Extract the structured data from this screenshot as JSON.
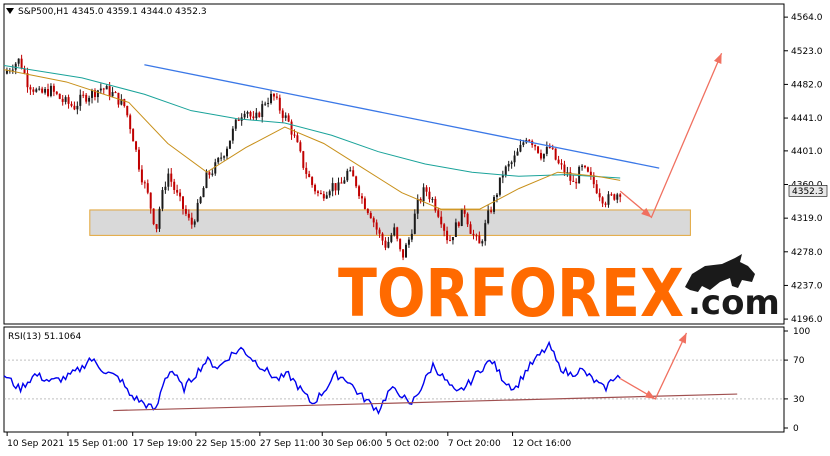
{
  "header": {
    "symbol_label": "S&P500,H1",
    "ohlc_label": "4345.0 4359.1 4344.0 4352.3"
  },
  "rsi": {
    "label": "RSI(13) 51.1064",
    "levels": [
      100,
      70,
      30,
      0
    ]
  },
  "watermark": {
    "brand_main": "TORFOREX",
    "brand_suffix": ".com"
  },
  "colors": {
    "candle_up": "#1a1a1a",
    "candle_down": "#c00000",
    "ma_fast": "#c8901a",
    "ma_slow": "#1aa39a",
    "trendline": "#3b78e7",
    "forecast_arrow": "#f07060",
    "rsi_line": "#0000ee",
    "rsi_support": "#a05050",
    "price_marker_bg": "#e8e8e8",
    "watermark_orange": "#ff6a00",
    "watermark_dark": "#1a1a1a"
  },
  "chart_data": {
    "type": "line",
    "instrument": "S&P500",
    "timeframe": "H1",
    "price_axis": {
      "ticks": [
        4564.0,
        4523.0,
        4482.0,
        4441.0,
        4401.0,
        4360.0,
        4319.0,
        4278.0,
        4237.0,
        4196.0
      ],
      "tick_labels": [
        "4564.0",
        "4523.0",
        "4482.0",
        "4441.0",
        "4401.0",
        "4360.0",
        "4319.0",
        "4278.0",
        "4237.0",
        "4196.0"
      ],
      "ylim": [
        4190,
        4580
      ]
    },
    "current_price": 4352.3,
    "current_price_label": "4352.3",
    "time_axis": {
      "labels": [
        "10 Sep 2021",
        "15 Sep 01:00",
        "17 Sep 19:00",
        "22 Sep 15:00",
        "27 Sep 11:00",
        "30 Sep 06:00",
        "5 Oct 02:00",
        "7 Oct 20:00",
        "12 Oct 16:00"
      ],
      "xlim": [
        0,
        1
      ]
    },
    "close_series": [
      [
        0.0,
        4495
      ],
      [
        0.01,
        4505
      ],
      [
        0.02,
        4512
      ],
      [
        0.03,
        4485
      ],
      [
        0.045,
        4470
      ],
      [
        0.06,
        4475
      ],
      [
        0.075,
        4462
      ],
      [
        0.09,
        4455
      ],
      [
        0.1,
        4465
      ],
      [
        0.11,
        4470
      ],
      [
        0.125,
        4478
      ],
      [
        0.14,
        4470
      ],
      [
        0.155,
        4455
      ],
      [
        0.165,
        4420
      ],
      [
        0.175,
        4375
      ],
      [
        0.185,
        4345
      ],
      [
        0.195,
        4305
      ],
      [
        0.2,
        4335
      ],
      [
        0.21,
        4375
      ],
      [
        0.22,
        4350
      ],
      [
        0.23,
        4330
      ],
      [
        0.24,
        4310
      ],
      [
        0.25,
        4335
      ],
      [
        0.26,
        4370
      ],
      [
        0.27,
        4380
      ],
      [
        0.285,
        4405
      ],
      [
        0.3,
        4440
      ],
      [
        0.31,
        4455
      ],
      [
        0.32,
        4435
      ],
      [
        0.335,
        4462
      ],
      [
        0.345,
        4468
      ],
      [
        0.355,
        4450
      ],
      [
        0.365,
        4435
      ],
      [
        0.375,
        4410
      ],
      [
        0.385,
        4380
      ],
      [
        0.395,
        4360
      ],
      [
        0.405,
        4345
      ],
      [
        0.42,
        4360
      ],
      [
        0.43,
        4355
      ],
      [
        0.44,
        4375
      ],
      [
        0.45,
        4365
      ],
      [
        0.46,
        4340
      ],
      [
        0.47,
        4325
      ],
      [
        0.48,
        4300
      ],
      [
        0.49,
        4285
      ],
      [
        0.5,
        4305
      ],
      [
        0.51,
        4270
      ],
      [
        0.52,
        4295
      ],
      [
        0.53,
        4335
      ],
      [
        0.54,
        4355
      ],
      [
        0.55,
        4340
      ],
      [
        0.56,
        4320
      ],
      [
        0.57,
        4290
      ],
      [
        0.58,
        4310
      ],
      [
        0.59,
        4330
      ],
      [
        0.6,
        4300
      ],
      [
        0.61,
        4285
      ],
      [
        0.62,
        4320
      ],
      [
        0.63,
        4345
      ],
      [
        0.64,
        4375
      ],
      [
        0.65,
        4385
      ],
      [
        0.66,
        4400
      ],
      [
        0.67,
        4420
      ],
      [
        0.68,
        4410
      ],
      [
        0.69,
        4395
      ],
      [
        0.7,
        4405
      ],
      [
        0.71,
        4385
      ],
      [
        0.72,
        4375
      ],
      [
        0.73,
        4360
      ],
      [
        0.74,
        4380
      ],
      [
        0.75,
        4370
      ],
      [
        0.76,
        4355
      ],
      [
        0.77,
        4340
      ],
      [
        0.78,
        4345
      ],
      [
        0.79,
        4352
      ]
    ],
    "ma_fast_series": [
      [
        0.0,
        4500
      ],
      [
        0.08,
        4485
      ],
      [
        0.16,
        4460
      ],
      [
        0.21,
        4410
      ],
      [
        0.26,
        4375
      ],
      [
        0.31,
        4405
      ],
      [
        0.36,
        4430
      ],
      [
        0.41,
        4410
      ],
      [
        0.46,
        4380
      ],
      [
        0.51,
        4350
      ],
      [
        0.56,
        4330
      ],
      [
        0.61,
        4330
      ],
      [
        0.66,
        4355
      ],
      [
        0.71,
        4375
      ],
      [
        0.76,
        4370
      ],
      [
        0.79,
        4365
      ]
    ],
    "ma_slow_series": [
      [
        0.0,
        4505
      ],
      [
        0.1,
        4490
      ],
      [
        0.18,
        4470
      ],
      [
        0.24,
        4450
      ],
      [
        0.3,
        4440
      ],
      [
        0.36,
        4435
      ],
      [
        0.42,
        4420
      ],
      [
        0.48,
        4400
      ],
      [
        0.54,
        4385
      ],
      [
        0.6,
        4375
      ],
      [
        0.66,
        4370
      ],
      [
        0.72,
        4372
      ],
      [
        0.79,
        4368
      ]
    ],
    "resistance_trendline": [
      [
        0.18,
        4506
      ],
      [
        0.84,
        4380
      ]
    ],
    "support_zone": [
      4298,
      4329
    ],
    "forecast_path": [
      [
        0.79,
        4352
      ],
      [
        0.83,
        4320
      ],
      [
        0.92,
        4520
      ]
    ],
    "rsi_series": [
      [
        0.0,
        55
      ],
      [
        0.02,
        40
      ],
      [
        0.04,
        55
      ],
      [
        0.06,
        48
      ],
      [
        0.08,
        52
      ],
      [
        0.1,
        62
      ],
      [
        0.11,
        72
      ],
      [
        0.13,
        58
      ],
      [
        0.15,
        50
      ],
      [
        0.16,
        35
      ],
      [
        0.18,
        25
      ],
      [
        0.195,
        18
      ],
      [
        0.205,
        50
      ],
      [
        0.215,
        60
      ],
      [
        0.23,
        40
      ],
      [
        0.245,
        55
      ],
      [
        0.26,
        70
      ],
      [
        0.275,
        62
      ],
      [
        0.29,
        75
      ],
      [
        0.305,
        82
      ],
      [
        0.32,
        70
      ],
      [
        0.335,
        60
      ],
      [
        0.35,
        50
      ],
      [
        0.365,
        55
      ],
      [
        0.38,
        40
      ],
      [
        0.395,
        25
      ],
      [
        0.41,
        38
      ],
      [
        0.425,
        55
      ],
      [
        0.44,
        50
      ],
      [
        0.455,
        35
      ],
      [
        0.47,
        25
      ],
      [
        0.48,
        18
      ],
      [
        0.495,
        40
      ],
      [
        0.51,
        35
      ],
      [
        0.52,
        22
      ],
      [
        0.535,
        42
      ],
      [
        0.55,
        65
      ],
      [
        0.565,
        50
      ],
      [
        0.58,
        35
      ],
      [
        0.595,
        45
      ],
      [
        0.61,
        60
      ],
      [
        0.625,
        70
      ],
      [
        0.64,
        50
      ],
      [
        0.655,
        40
      ],
      [
        0.67,
        60
      ],
      [
        0.69,
        78
      ],
      [
        0.7,
        85
      ],
      [
        0.71,
        65
      ],
      [
        0.725,
        55
      ],
      [
        0.74,
        60
      ],
      [
        0.755,
        50
      ],
      [
        0.77,
        40
      ],
      [
        0.785,
        55
      ],
      [
        0.79,
        51
      ]
    ],
    "rsi_support_line": [
      [
        0.14,
        18
      ],
      [
        0.94,
        35
      ]
    ],
    "rsi_forecast_path": [
      [
        0.79,
        51
      ],
      [
        0.835,
        30
      ],
      [
        0.875,
        98
      ]
    ]
  }
}
